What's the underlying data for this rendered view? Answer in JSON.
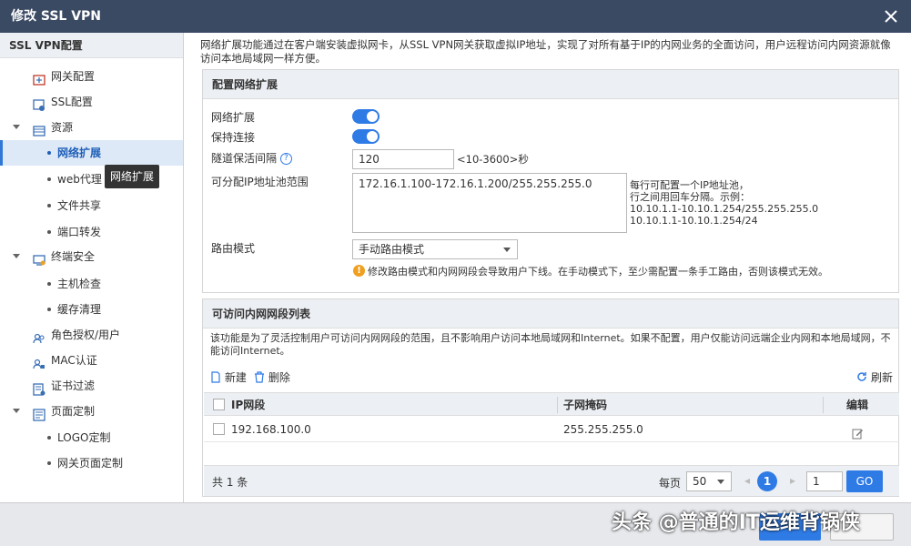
{
  "window": {
    "title": "修改 SSL VPN"
  },
  "sidebar": {
    "title": "SSL VPN配置",
    "items": [
      {
        "label": "网关配置",
        "icon": "gateway-icon"
      },
      {
        "label": "SSL配置",
        "icon": "ssl-icon"
      },
      {
        "label": "资源",
        "icon": "resource-icon"
      },
      {
        "label": "网络扩展"
      },
      {
        "label": "web代理"
      },
      {
        "label": "文件共享"
      },
      {
        "label": "端口转发"
      },
      {
        "label": "终端安全",
        "icon": "terminal-icon"
      },
      {
        "label": "主机检查"
      },
      {
        "label": "缓存清理"
      },
      {
        "label": "角色授权/用户",
        "icon": "users-icon"
      },
      {
        "label": "MAC认证",
        "icon": "mac-auth-icon"
      },
      {
        "label": "证书过滤",
        "icon": "certificate-icon"
      },
      {
        "label": "页面定制",
        "icon": "page-icon"
      },
      {
        "label": "LOGO定制"
      },
      {
        "label": "网关页面定制"
      }
    ],
    "tooltip": "网络扩展"
  },
  "main": {
    "description": "网络扩展功能通过在客户端安装虚拟网卡，从SSL VPN网关获取虚拟IP地址，实现了对所有基于IP的内网业务的全面访问，用户远程访问内网资源就像访问本地局域网一样方便。",
    "config": {
      "header": "配置网络扩展",
      "network_ext_label": "网络扩展",
      "keepalive_label": "保持连接",
      "tunnel_interval_label": "隧道保活间隔",
      "tunnel_interval_value": "120",
      "tunnel_interval_hint": "<10-3600>秒",
      "ip_pool_label": "可分配IP地址池范围",
      "ip_pool_value": "172.16.1.100-172.16.1.200/255.255.255.0",
      "ip_pool_hint_1": "每行可配置一个IP地址池，",
      "ip_pool_hint_2": "行之间用回车分隔。示例：",
      "ip_pool_hint_3": "10.10.1.1-10.10.1.254/255.255.255.0",
      "ip_pool_hint_4": "10.10.1.1-10.10.1.254/24",
      "route_mode_label": "路由模式",
      "route_mode_value": "手动路由模式",
      "route_warning": "修改路由模式和内网网段会导致用户下线。在手动模式下，至少需配置一条手工路由，否则该模式无效。"
    },
    "list": {
      "header": "可访问内网网段列表",
      "description": "该功能是为了灵活控制用户可访问内网网段的范围，且不影响用户访问本地局域网和Internet。如果不配置，用户仅能访问远端企业内网和本地局域网，不能访问Internet。",
      "new_label": "新建",
      "delete_label": "删除",
      "refresh_label": "刷新",
      "columns": [
        "IP网段",
        "子网掩码",
        "编辑"
      ],
      "rows": [
        {
          "ip": "192.168.100.0",
          "mask": "255.255.255.0"
        }
      ],
      "total": "共 1 条",
      "per_page_label": "每页",
      "per_page_value": "50",
      "current_page": "1",
      "page_input": "1",
      "go_label": "GO"
    }
  },
  "watermark": "头条 @普通的IT运维背锅侠",
  "colors": {
    "accent": "#2f7be6",
    "titlebar": "#3b4a63"
  }
}
